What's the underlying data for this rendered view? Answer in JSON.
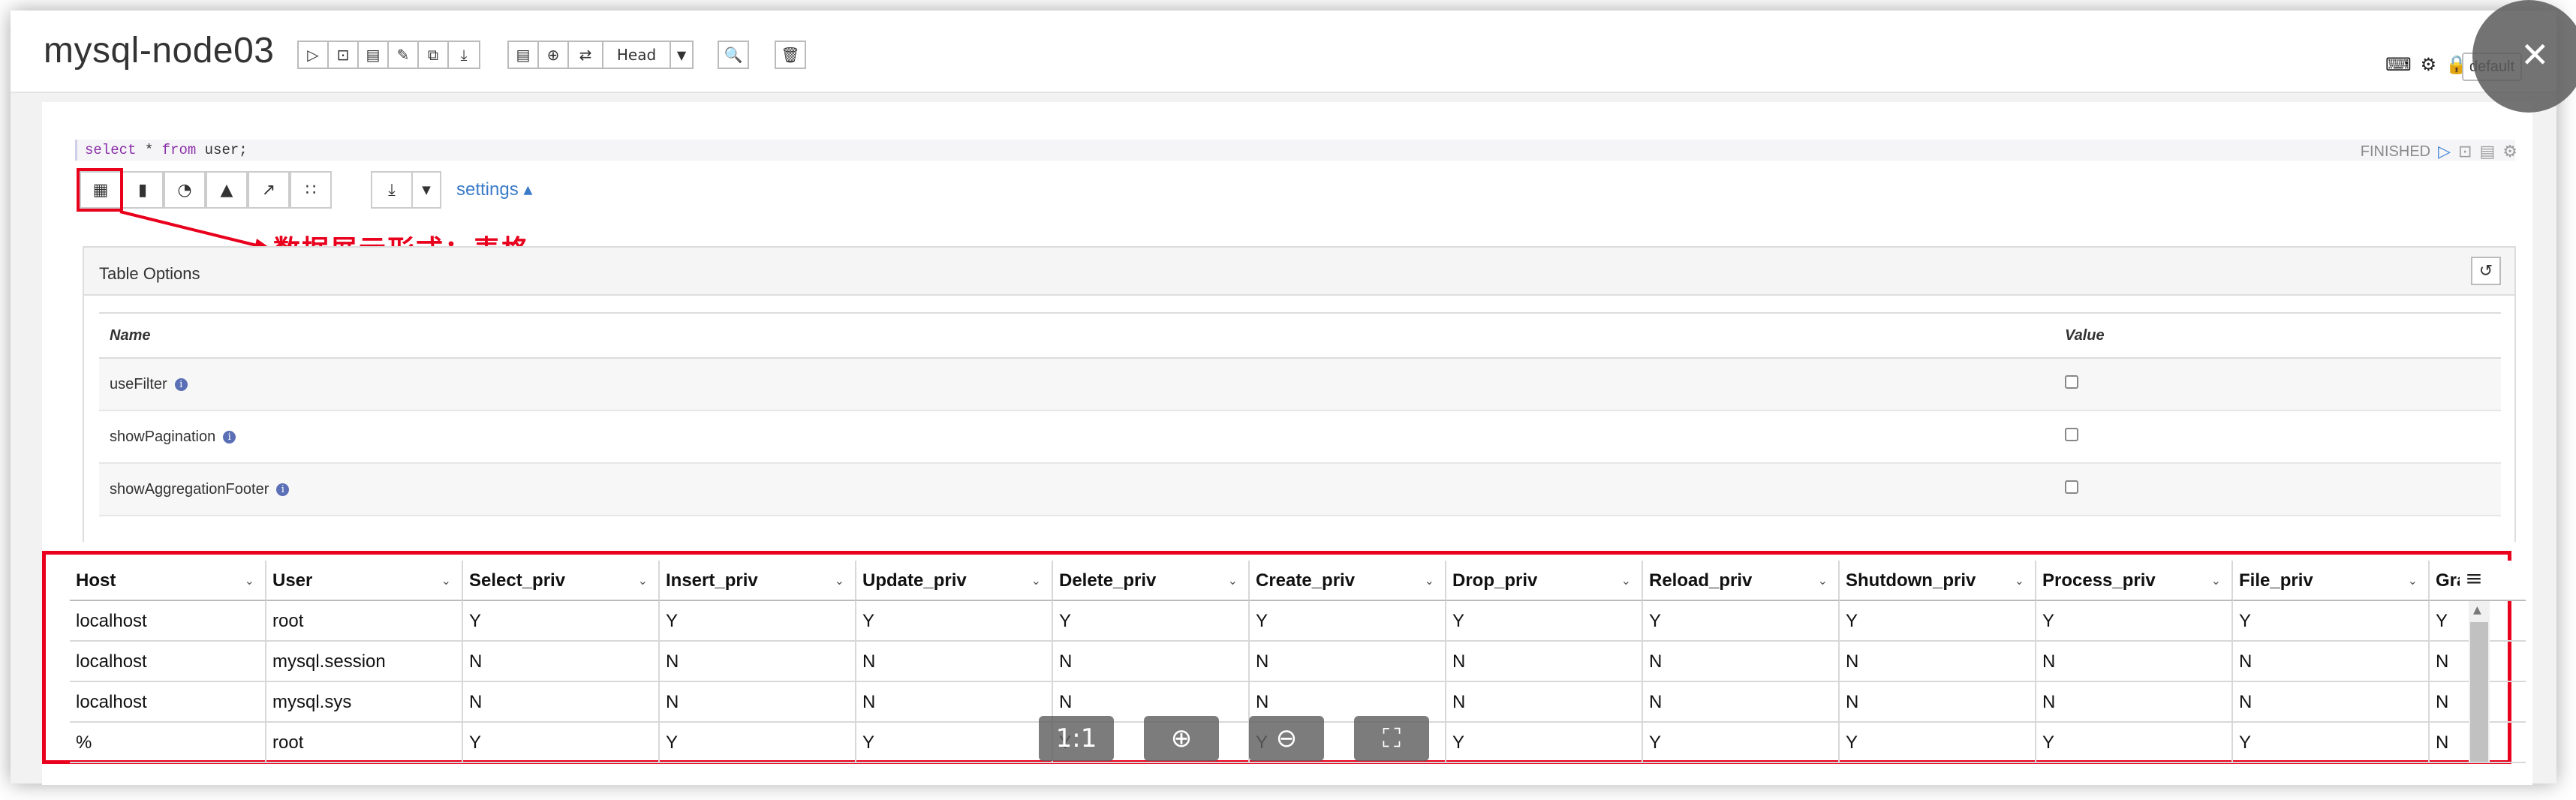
{
  "notebook": {
    "title": "mysql-node03",
    "head_label": "Head",
    "interpreter_label": "default"
  },
  "paragraph": {
    "sql_keyword_select": "select",
    "sql_star": " * ",
    "sql_keyword_from": "from",
    "sql_rest": " user;",
    "status": "FINISHED",
    "settings_label": "settings ▴"
  },
  "annotation": {
    "text": "数据展示形式：表格",
    "color": "#e8001c"
  },
  "table_options": {
    "title": "Table Options",
    "col_name": "Name",
    "col_value": "Value",
    "rows": [
      {
        "name": "useFilter"
      },
      {
        "name": "showPagination"
      },
      {
        "name": "showAggregationFooter"
      }
    ]
  },
  "grid": {
    "columns": [
      "Host",
      "User",
      "Select_priv",
      "Insert_priv",
      "Update_priv",
      "Delete_priv",
      "Create_priv",
      "Drop_priv",
      "Reload_priv",
      "Shutdown_priv",
      "Process_priv",
      "File_priv",
      "Gra"
    ],
    "rows": [
      [
        "localhost",
        "root",
        "Y",
        "Y",
        "Y",
        "Y",
        "Y",
        "Y",
        "Y",
        "Y",
        "Y",
        "Y",
        "Y"
      ],
      [
        "localhost",
        "mysql.session",
        "N",
        "N",
        "N",
        "N",
        "N",
        "N",
        "N",
        "N",
        "N",
        "N",
        "N"
      ],
      [
        "localhost",
        "mysql.sys",
        "N",
        "N",
        "N",
        "N",
        "N",
        "N",
        "N",
        "N",
        "N",
        "N",
        "N"
      ],
      [
        "%",
        "root",
        "Y",
        "Y",
        "Y",
        "Y",
        "Y",
        "Y",
        "Y",
        "Y",
        "Y",
        "Y",
        "N"
      ]
    ]
  },
  "viewer": {
    "actual_size_label": "1:1"
  },
  "icons": {
    "accent": "#3b7fd4",
    "annotation_red": "#e8001c"
  }
}
